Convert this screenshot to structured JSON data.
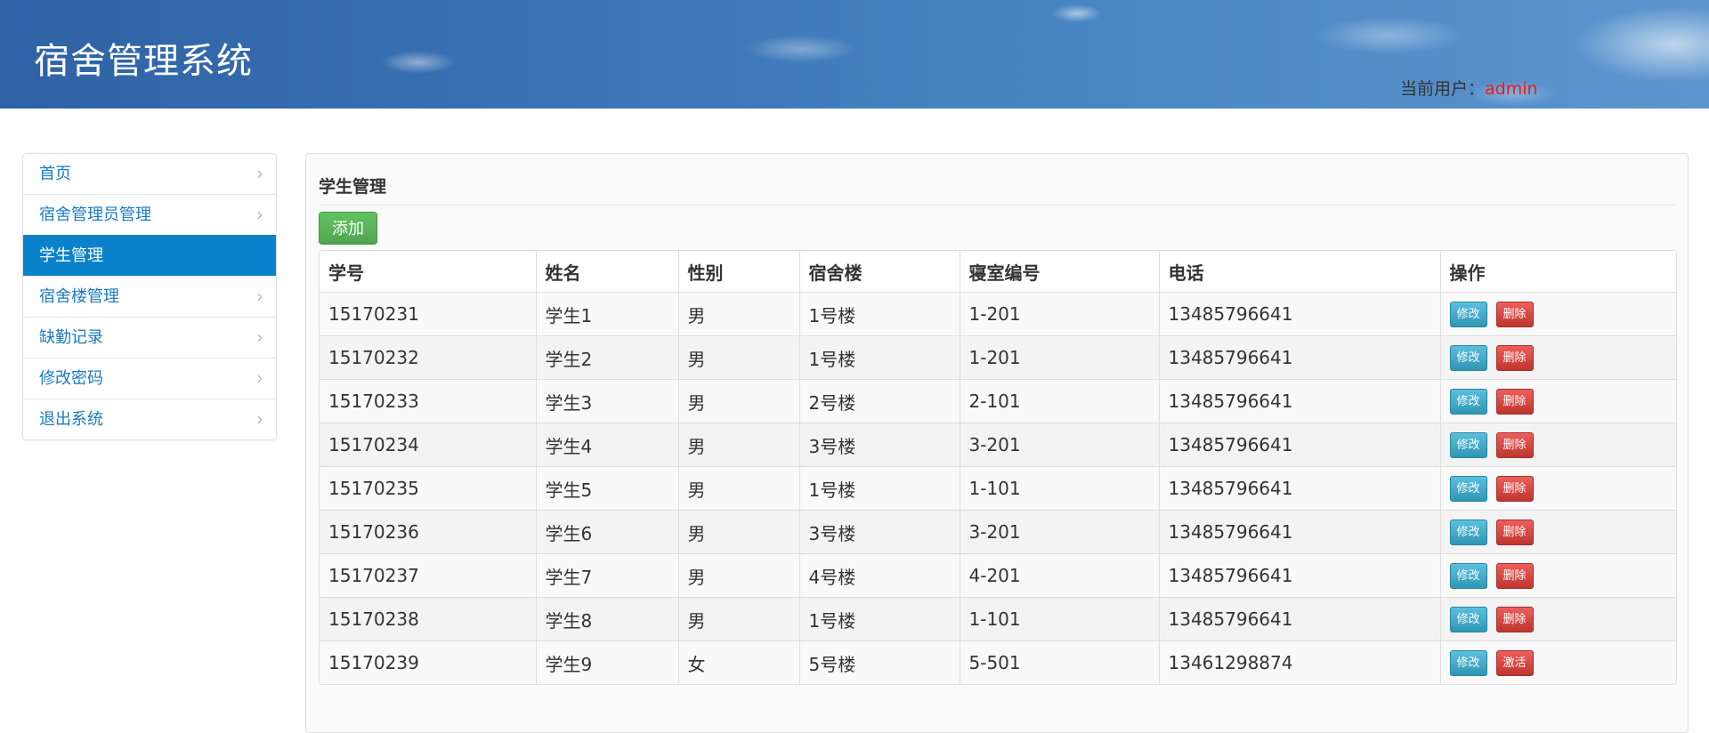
{
  "header": {
    "title": "宿舍管理系统",
    "user_label": "当前用户：",
    "user_name": "admin"
  },
  "sidebar": {
    "items": [
      {
        "label": "首页",
        "active": false
      },
      {
        "label": "宿舍管理员管理",
        "active": false
      },
      {
        "label": "学生管理",
        "active": true
      },
      {
        "label": "宿舍楼管理",
        "active": false
      },
      {
        "label": "缺勤记录",
        "active": false
      },
      {
        "label": "修改密码",
        "active": false
      },
      {
        "label": "退出系统",
        "active": false
      }
    ]
  },
  "main": {
    "title": "学生管理",
    "add_label": "添加",
    "table": {
      "columns": [
        "学号",
        "姓名",
        "性别",
        "宿舍楼",
        "寝室编号",
        "电话",
        "操作"
      ],
      "rows": [
        {
          "id": "15170231",
          "name": "学生1",
          "gender": "男",
          "building": "1号楼",
          "room": "1-201",
          "phone": "13485796641",
          "edit": "修改",
          "action": "删除"
        },
        {
          "id": "15170232",
          "name": "学生2",
          "gender": "男",
          "building": "1号楼",
          "room": "1-201",
          "phone": "13485796641",
          "edit": "修改",
          "action": "删除"
        },
        {
          "id": "15170233",
          "name": "学生3",
          "gender": "男",
          "building": "2号楼",
          "room": "2-101",
          "phone": "13485796641",
          "edit": "修改",
          "action": "删除"
        },
        {
          "id": "15170234",
          "name": "学生4",
          "gender": "男",
          "building": "3号楼",
          "room": "3-201",
          "phone": "13485796641",
          "edit": "修改",
          "action": "删除"
        },
        {
          "id": "15170235",
          "name": "学生5",
          "gender": "男",
          "building": "1号楼",
          "room": "1-101",
          "phone": "13485796641",
          "edit": "修改",
          "action": "删除"
        },
        {
          "id": "15170236",
          "name": "学生6",
          "gender": "男",
          "building": "3号楼",
          "room": "3-201",
          "phone": "13485796641",
          "edit": "修改",
          "action": "删除"
        },
        {
          "id": "15170237",
          "name": "学生7",
          "gender": "男",
          "building": "4号楼",
          "room": "4-201",
          "phone": "13485796641",
          "edit": "修改",
          "action": "删除"
        },
        {
          "id": "15170238",
          "name": "学生8",
          "gender": "男",
          "building": "1号楼",
          "room": "1-101",
          "phone": "13485796641",
          "edit": "修改",
          "action": "删除"
        },
        {
          "id": "15170239",
          "name": "学生9",
          "gender": "女",
          "building": "5号楼",
          "room": "5-501",
          "phone": "13461298874",
          "edit": "修改",
          "action": "激活"
        }
      ]
    }
  },
  "colors": {
    "header_blue": "#3b74b5",
    "nav_active": "#0a82cb",
    "nav_link": "#1a7ac5",
    "add_green": "#5cb85c",
    "edit_blue": "#5bc0de",
    "delete_red": "#d9534f",
    "user_red": "#e81c1c"
  },
  "icons": {
    "nav_arrow": "chevron-right-icon"
  }
}
